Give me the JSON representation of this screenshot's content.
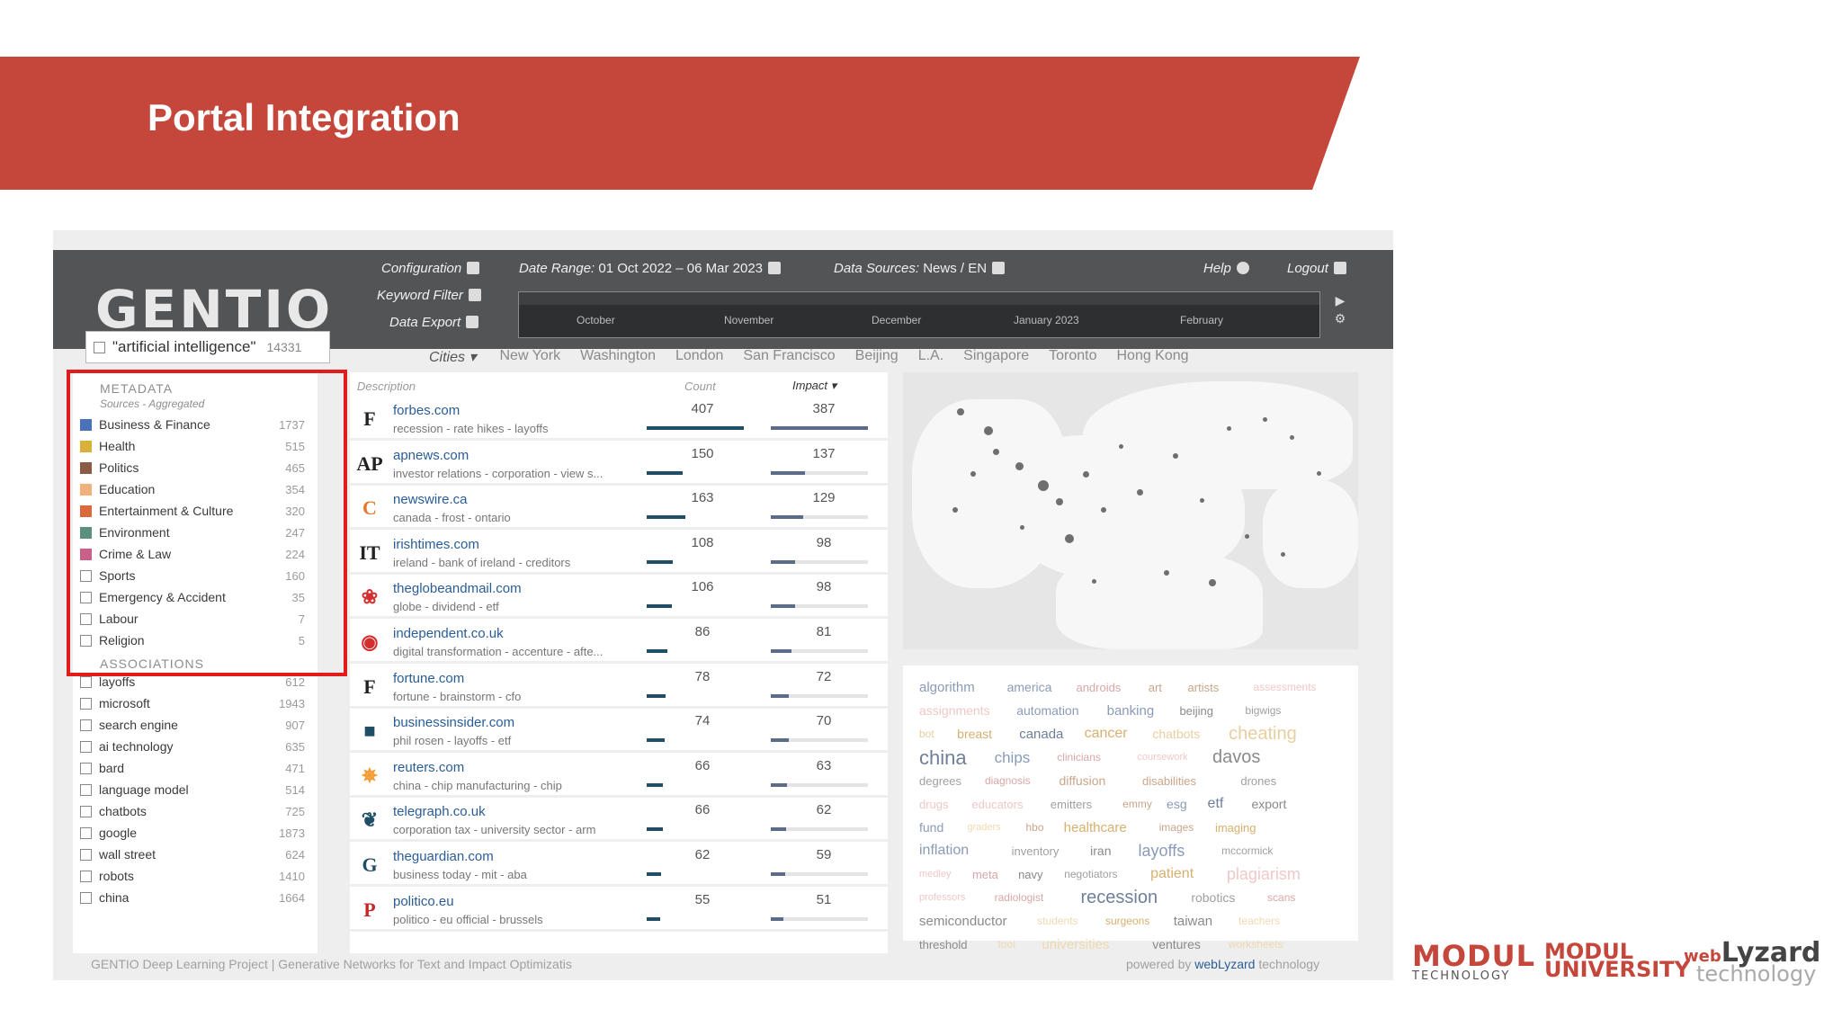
{
  "slide": {
    "title": "Portal Integration",
    "accent_color": "#c5473b"
  },
  "app": {
    "logo": "GENTIO",
    "search": {
      "query": "\"artificial intelligence\"",
      "count": "14331"
    },
    "menu": {
      "configuration": "Configuration",
      "keyword_filter": "Keyword Filter",
      "data_export": "Data Export",
      "date_range_label": "Date Range:",
      "date_range_value": "01 Oct 2022 – 06 Mar 2023",
      "data_sources_label": "Data Sources:",
      "data_sources_value": "News / EN",
      "help": "Help",
      "logout": "Logout"
    },
    "timeline_months": [
      "October",
      "November",
      "December",
      "January 2023",
      "February"
    ],
    "cities_label": "Cities",
    "cities": [
      "New York",
      "Washington",
      "London",
      "San Francisco",
      "Beijing",
      "L.A.",
      "Singapore",
      "Toronto",
      "Hong Kong"
    ],
    "metadata": {
      "title": "METADATA",
      "subtitle": "Sources - Aggregated",
      "items": [
        {
          "label": "Business & Finance",
          "count": "1737",
          "color": "#4a72b8"
        },
        {
          "label": "Health",
          "count": "515",
          "color": "#d8b13b"
        },
        {
          "label": "Politics",
          "count": "465",
          "color": "#8b5a45"
        },
        {
          "label": "Education",
          "count": "354",
          "color": "#f0b27a"
        },
        {
          "label": "Entertainment & Culture",
          "count": "320",
          "color": "#d96a3b"
        },
        {
          "label": "Environment",
          "count": "247",
          "color": "#5b8f7f"
        },
        {
          "label": "Crime & Law",
          "count": "224",
          "color": "#c9608a"
        },
        {
          "label": "Sports",
          "count": "160",
          "color": ""
        },
        {
          "label": "Emergency & Accident",
          "count": "35",
          "color": ""
        },
        {
          "label": "Labour",
          "count": "7",
          "color": ""
        },
        {
          "label": "Religion",
          "count": "5",
          "color": ""
        }
      ]
    },
    "associations": {
      "title": "ASSOCIATIONS",
      "items": [
        {
          "label": "layoffs",
          "count": "612"
        },
        {
          "label": "microsoft",
          "count": "1943"
        },
        {
          "label": "search engine",
          "count": "907"
        },
        {
          "label": "ai technology",
          "count": "635"
        },
        {
          "label": "bard",
          "count": "471"
        },
        {
          "label": "language model",
          "count": "514"
        },
        {
          "label": "chatbots",
          "count": "725"
        },
        {
          "label": "google",
          "count": "1873"
        },
        {
          "label": "wall street",
          "count": "624"
        },
        {
          "label": "robots",
          "count": "1410"
        },
        {
          "label": "china",
          "count": "1664"
        }
      ]
    },
    "list_header": {
      "description": "Description",
      "count": "Count",
      "impact": "Impact"
    },
    "sources": [
      {
        "logo": "F",
        "name": "forbes.com",
        "desc": "recession - rate hikes - layoffs",
        "count": 407,
        "impact": 387
      },
      {
        "logo": "AP",
        "name": "apnews.com",
        "desc": "investor relations - corporation - view s...",
        "count": 150,
        "impact": 137
      },
      {
        "logo": "C",
        "name": "newswire.ca",
        "desc": "canada - frost - ontario",
        "count": 163,
        "impact": 129
      },
      {
        "logo": "IT",
        "name": "irishtimes.com",
        "desc": "ireland - bank of ireland - creditors",
        "count": 108,
        "impact": 98
      },
      {
        "logo": "❀",
        "name": "theglobeandmail.com",
        "desc": "globe - dividend - etf",
        "count": 106,
        "impact": 98
      },
      {
        "logo": "◉",
        "name": "independent.co.uk",
        "desc": "digital transformation - accenture - afte...",
        "count": 86,
        "impact": 81
      },
      {
        "logo": "F",
        "name": "fortune.com",
        "desc": "fortune - brainstorm - cfo",
        "count": 78,
        "impact": 72
      },
      {
        "logo": "■",
        "name": "businessinsider.com",
        "desc": "phil rosen - layoffs - etf",
        "count": 74,
        "impact": 70
      },
      {
        "logo": "✵",
        "name": "reuters.com",
        "desc": "china - chip manufacturing - chip",
        "count": 66,
        "impact": 63
      },
      {
        "logo": "❦",
        "name": "telegraph.co.uk",
        "desc": "corporation tax - university sector - arm",
        "count": 66,
        "impact": 62
      },
      {
        "logo": "G",
        "name": "theguardian.com",
        "desc": "business today - mit - aba",
        "count": 62,
        "impact": 59
      },
      {
        "logo": "P",
        "name": "politico.eu",
        "desc": "politico - eu official - brussels",
        "count": 55,
        "impact": 51
      }
    ],
    "word_cloud": [
      {
        "w": "algorithm",
        "s": 15,
        "c": "#8a9bb8"
      },
      {
        "w": "america",
        "s": 14,
        "c": "#8a9bb8"
      },
      {
        "w": "androids",
        "s": 13,
        "c": "#d8a7a7"
      },
      {
        "w": "art",
        "s": 13,
        "c": "#c9a68a"
      },
      {
        "w": "artists",
        "s": 13,
        "c": "#c9a68a"
      },
      {
        "w": "assessments",
        "s": 12,
        "c": "#f0c8c8"
      },
      {
        "w": "assignments",
        "s": 14,
        "c": "#f0c8c8"
      },
      {
        "w": "automation",
        "s": 14,
        "c": "#8a9bb8"
      },
      {
        "w": "banking",
        "s": 15,
        "c": "#8a9bb8"
      },
      {
        "w": "beijing",
        "s": 13,
        "c": "#8a8a8a"
      },
      {
        "w": "bigwigs",
        "s": 12,
        "c": "#a0a0a0"
      },
      {
        "w": "bot",
        "s": 12,
        "c": "#e8cfa0"
      },
      {
        "w": "breast",
        "s": 14,
        "c": "#d8b070"
      },
      {
        "w": "canada",
        "s": 15,
        "c": "#6f7f9a"
      },
      {
        "w": "cancer",
        "s": 16,
        "c": "#d8b070"
      },
      {
        "w": "chatbots",
        "s": 14,
        "c": "#e8cfa0"
      },
      {
        "w": "cheating",
        "s": 20,
        "c": "#e8cfa0"
      },
      {
        "w": "china",
        "s": 22,
        "c": "#6f7f9a"
      },
      {
        "w": "chips",
        "s": 17,
        "c": "#8a9bb8"
      },
      {
        "w": "clinicians",
        "s": 12,
        "c": "#d8a7a7"
      },
      {
        "w": "coursework",
        "s": 11,
        "c": "#f0c8c8"
      },
      {
        "w": "davos",
        "s": 20,
        "c": "#8a8a8a"
      },
      {
        "w": "degrees",
        "s": 13,
        "c": "#a0a0a0"
      },
      {
        "w": "diagnosis",
        "s": 12,
        "c": "#d8a7a7"
      },
      {
        "w": "diffusion",
        "s": 14,
        "c": "#c9a68a"
      },
      {
        "w": "disabilities",
        "s": 13,
        "c": "#c9a68a"
      },
      {
        "w": "drones",
        "s": 13,
        "c": "#a0a0a0"
      },
      {
        "w": "drugs",
        "s": 13,
        "c": "#f0c8c8"
      },
      {
        "w": "educators",
        "s": 13,
        "c": "#f0c8c8"
      },
      {
        "w": "emitters",
        "s": 13,
        "c": "#a0a0a0"
      },
      {
        "w": "emmy",
        "s": 12,
        "c": "#c9a68a"
      },
      {
        "w": "esg",
        "s": 14,
        "c": "#8a9bb8"
      },
      {
        "w": "etf",
        "s": 16,
        "c": "#6f7f9a"
      },
      {
        "w": "export",
        "s": 14,
        "c": "#8a8a8a"
      },
      {
        "w": "fund",
        "s": 14,
        "c": "#8a9bb8"
      },
      {
        "w": "graders",
        "s": 11,
        "c": "#f0d8b0"
      },
      {
        "w": "hbo",
        "s": 12,
        "c": "#c9a68a"
      },
      {
        "w": "healthcare",
        "s": 15,
        "c": "#d8b070"
      },
      {
        "w": "images",
        "s": 12,
        "c": "#c9a68a"
      },
      {
        "w": "imaging",
        "s": 13,
        "c": "#d8b070"
      },
      {
        "w": "inflation",
        "s": 16,
        "c": "#8a9bb8"
      },
      {
        "w": "inventory",
        "s": 13,
        "c": "#a0a0a0"
      },
      {
        "w": "iran",
        "s": 14,
        "c": "#8a8a8a"
      },
      {
        "w": "layoffs",
        "s": 18,
        "c": "#8a9bb8"
      },
      {
        "w": "mccormick",
        "s": 12,
        "c": "#a0a0a0"
      },
      {
        "w": "medley",
        "s": 11,
        "c": "#f0c8c8"
      },
      {
        "w": "meta",
        "s": 13,
        "c": "#d8a7a7"
      },
      {
        "w": "navy",
        "s": 13,
        "c": "#8a8a8a"
      },
      {
        "w": "negotiators",
        "s": 12,
        "c": "#a0a0a0"
      },
      {
        "w": "patient",
        "s": 16,
        "c": "#d8b070"
      },
      {
        "w": "plagiarism",
        "s": 18,
        "c": "#f0c8c8"
      },
      {
        "w": "professors",
        "s": 11,
        "c": "#f0c8c8"
      },
      {
        "w": "radiologist",
        "s": 12,
        "c": "#d8a7a7"
      },
      {
        "w": "recession",
        "s": 20,
        "c": "#6f7f9a"
      },
      {
        "w": "robotics",
        "s": 14,
        "c": "#a0a0a0"
      },
      {
        "w": "scans",
        "s": 12,
        "c": "#d8a7a7"
      },
      {
        "w": "semiconductor",
        "s": 15,
        "c": "#8a8a8a"
      },
      {
        "w": "students",
        "s": 12,
        "c": "#f0d8b0"
      },
      {
        "w": "surgeons",
        "s": 12,
        "c": "#d8b070"
      },
      {
        "w": "taiwan",
        "s": 15,
        "c": "#8a8a8a"
      },
      {
        "w": "teachers",
        "s": 12,
        "c": "#f0d8b0"
      },
      {
        "w": "threshold",
        "s": 13,
        "c": "#8a8a8a"
      },
      {
        "w": "tool",
        "s": 12,
        "c": "#f0d8b0"
      },
      {
        "w": "universities",
        "s": 15,
        "c": "#f0d8b0"
      },
      {
        "w": "ventures",
        "s": 14,
        "c": "#8a8a8a"
      },
      {
        "w": "worksheets",
        "s": 12,
        "c": "#f0d8b0"
      }
    ],
    "footer_left": "GENTIO Deep Learning Project | Generative Networks for Text and Impact Optimizatis",
    "footer_right_pre": "powered by ",
    "footer_right_brand": "webLyzard",
    "footer_right_post": " technology"
  },
  "logos": {
    "modul_tech_main": "MODUL",
    "modul_tech_sub": "TECHNOLOGY",
    "modul_uni_a": "MODUL",
    "modul_uni_b": "UNIVERSITY",
    "weblyzard_a": "web",
    "weblyzard_b": "Lyzard",
    "weblyzard_c": "technology"
  }
}
